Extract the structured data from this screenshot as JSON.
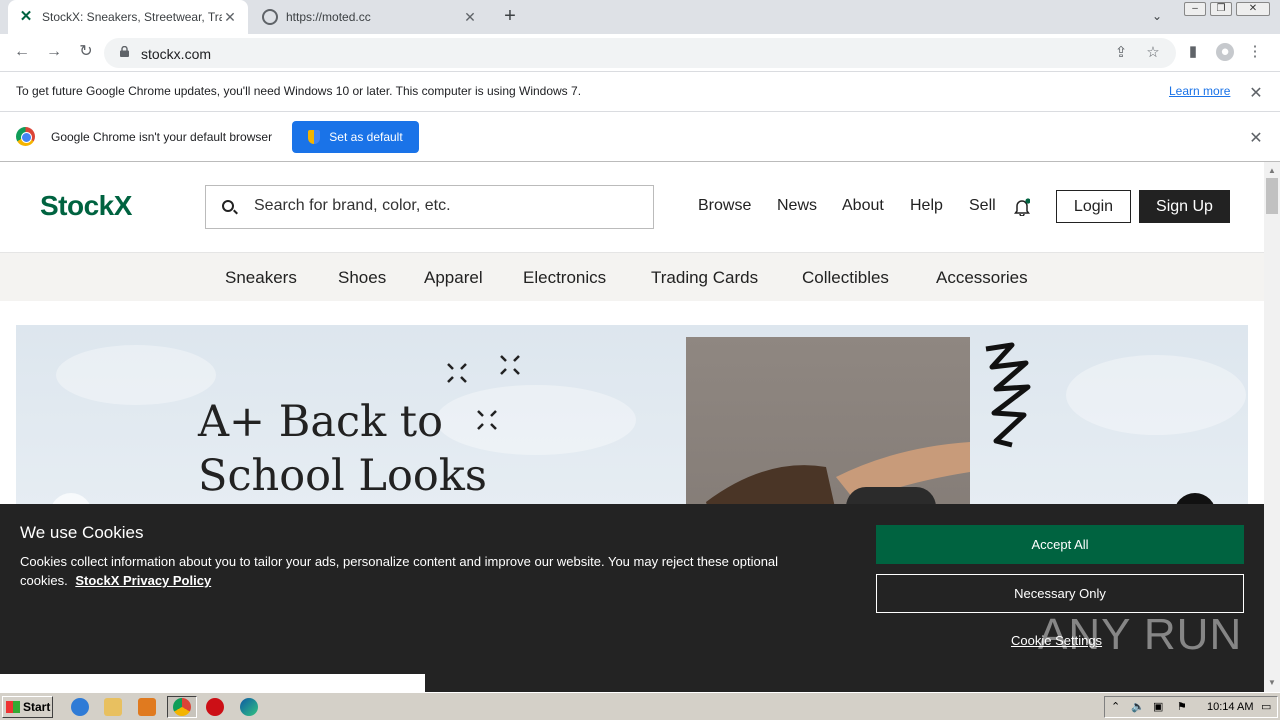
{
  "browser": {
    "tabs": [
      {
        "title": "StockX: Sneakers, Streetwear, Tradi",
        "active": true
      },
      {
        "title": "https://moted.cc",
        "active": false
      }
    ],
    "new_tab_icon": "+",
    "address": "stockx.com",
    "window_controls": [
      "minimize",
      "restore",
      "close"
    ]
  },
  "infobar_update": {
    "message": "To get future Google Chrome updates, you'll need Windows 10 or later. This computer is using Windows 7.",
    "link": "Learn more"
  },
  "infobar_default": {
    "message": "Google Chrome isn't your default browser",
    "button": "Set as default"
  },
  "site": {
    "logo": "StockX",
    "search_placeholder": "Search for brand, color, etc.",
    "nav": [
      "Browse",
      "News",
      "About",
      "Help",
      "Sell"
    ],
    "login": "Login",
    "signup": "Sign Up",
    "categories": [
      "Sneakers",
      "Shoes",
      "Apparel",
      "Electronics",
      "Trading Cards",
      "Collectibles",
      "Accessories"
    ],
    "hero": {
      "title_line1": "A+ Back to",
      "title_line2": "School Looks"
    },
    "colors": {
      "brand": "#006340",
      "dark": "#232323"
    }
  },
  "cookie": {
    "heading": "We use Cookies",
    "text": "Cookies collect information about you to tailor your ads, personalize content and improve our website. You may reject these optional cookies.",
    "policy_link": "StockX Privacy Policy",
    "accept_all": "Accept All",
    "necessary_only": "Necessary Only",
    "settings": "Cookie Settings"
  },
  "watermark": "ANY RUN",
  "taskbar": {
    "start": "Start",
    "clock": "10:14 AM"
  }
}
